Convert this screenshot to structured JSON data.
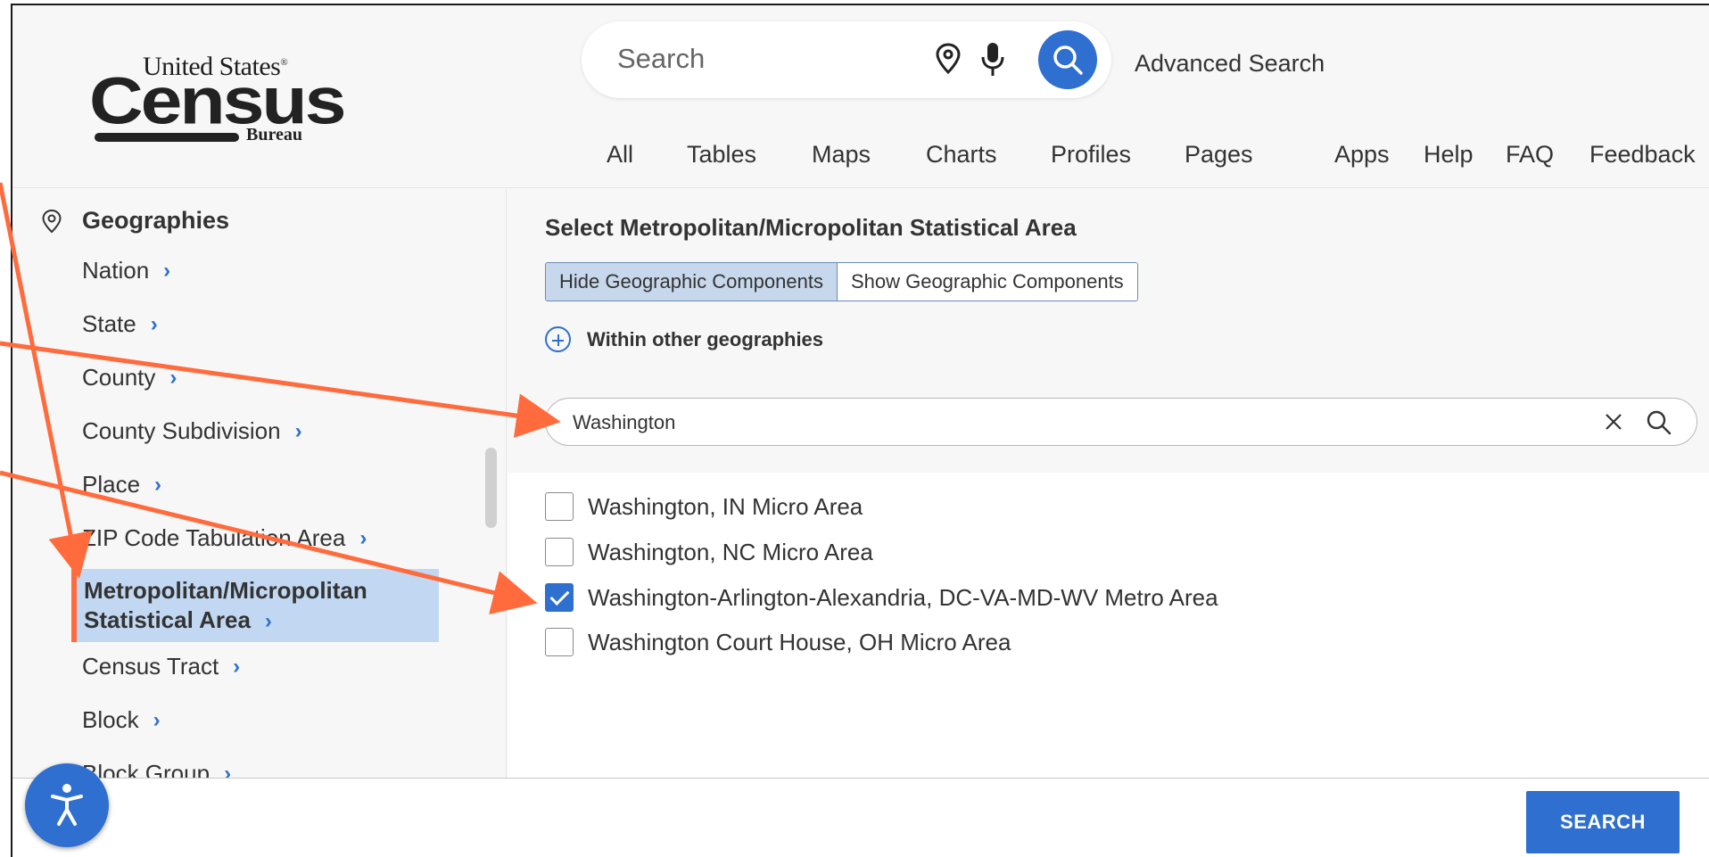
{
  "header": {
    "logo": {
      "line1": "United States",
      "reg": "®",
      "line2": "Census",
      "line3": "Bureau"
    },
    "search": {
      "placeholder": "Search"
    },
    "advanced_search": "Advanced Search",
    "nav": [
      "All",
      "Tables",
      "Maps",
      "Charts",
      "Profiles",
      "Pages",
      "Apps",
      "Help",
      "FAQ",
      "Feedback"
    ]
  },
  "sidebar": {
    "heading": "Geographies",
    "items": [
      {
        "label": "Nation"
      },
      {
        "label": "State"
      },
      {
        "label": "County"
      },
      {
        "label": "County Subdivision"
      },
      {
        "label": "Place"
      },
      {
        "label": "ZIP Code Tabulation Area"
      },
      {
        "label_line1": "Metropolitan/Micropolitan",
        "label_line2": "Statistical Area",
        "active": true
      },
      {
        "label": "Census Tract"
      },
      {
        "label": "Block"
      },
      {
        "label": "Block Group"
      }
    ]
  },
  "main": {
    "title": "Select Metropolitan/Micropolitan Statistical Area",
    "toggle": {
      "hide": "Hide Geographic Components",
      "show": "Show Geographic Components",
      "selected": "hide"
    },
    "within": "Within other geographies",
    "filter": {
      "value": "Washington"
    },
    "results": [
      {
        "label": "Washington, IN Micro Area",
        "checked": false
      },
      {
        "label": "Washington, NC Micro Area",
        "checked": false
      },
      {
        "label": "Washington-Arlington-Alexandria, DC-VA-MD-WV Metro Area",
        "checked": true
      },
      {
        "label": "Washington Court House, OH Micro Area",
        "checked": false
      }
    ]
  },
  "footer": {
    "search_button": "SEARCH"
  },
  "colors": {
    "accent": "#2e6fcf",
    "annotation": "#ff6b3d",
    "active_bg": "#c2d8f2"
  },
  "icons": [
    "map-pin-icon",
    "microphone-icon",
    "search-icon",
    "plus-circle-icon",
    "clear-icon",
    "chevron-right-icon",
    "accessibility-icon"
  ]
}
